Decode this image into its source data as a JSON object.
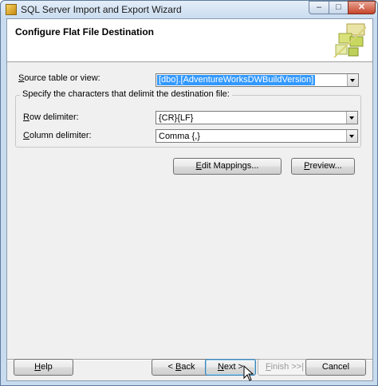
{
  "window": {
    "title": "SQL Server Import and Export Wizard",
    "controls": {
      "minimize": "–",
      "maximize": "□",
      "close": "✕"
    }
  },
  "header": {
    "title": "Configure Flat File Destination",
    "icon": "wizard-art-icon"
  },
  "source": {
    "label_accel": "S",
    "label_rest": "ource table or view:",
    "value": "[dbo].[AdventureWorksDWBuildVersion]"
  },
  "delimiters": {
    "group_title": "Specify the characters that delimit the destination file:",
    "row_label_accel": "R",
    "row_label_rest": "ow delimiter:",
    "row_value": "{CR}{LF}",
    "column_label_accel": "C",
    "column_label_rest": "olumn delimiter:",
    "column_value": "Comma {,}"
  },
  "actions": {
    "edit_mappings_accel": "E",
    "edit_mappings_rest": "dit Mappings...",
    "preview_accel": "P",
    "preview_rest": "review..."
  },
  "footer": {
    "help_accel": "H",
    "help_rest": "elp",
    "back_prefix": "< ",
    "back_accel": "B",
    "back_rest": "ack",
    "next_accel": "N",
    "next_rest": "ext >",
    "finish_accel": "F",
    "finish_rest": "inish >>|",
    "cancel": "Cancel"
  }
}
